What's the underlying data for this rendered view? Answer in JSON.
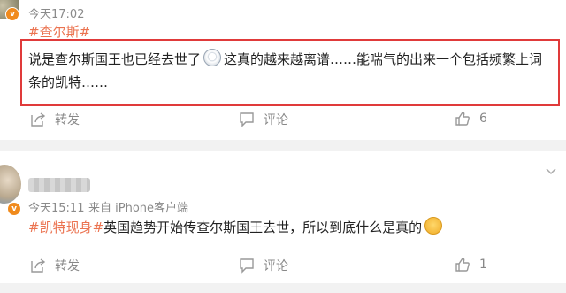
{
  "post1": {
    "time": "今天17:02",
    "hashtag": "#查尔斯#",
    "line1_before_emoji": "说是查尔斯国王也已经去世了",
    "line1_after_emoji": "这真的越来越离谱……能喘气的出来一个包括频繁上词",
    "line2": "条的凯特……",
    "actions": {
      "share": "转发",
      "comment": "评论",
      "like_count": "6"
    }
  },
  "post2": {
    "time": "今天15:11",
    "source": "来自 iPhone客户端",
    "hashtag": "#凯特现身#",
    "text": "英国趋势开始传查尔斯国王去世，所以到底什么是真的",
    "actions": {
      "share": "转发",
      "comment": "评论",
      "like_count": "1"
    }
  },
  "badge_letter": "v",
  "colors": {
    "hashtag": "#eb7350",
    "highlight_border": "#e03a3a",
    "verified_badge": "#f08a1c"
  }
}
